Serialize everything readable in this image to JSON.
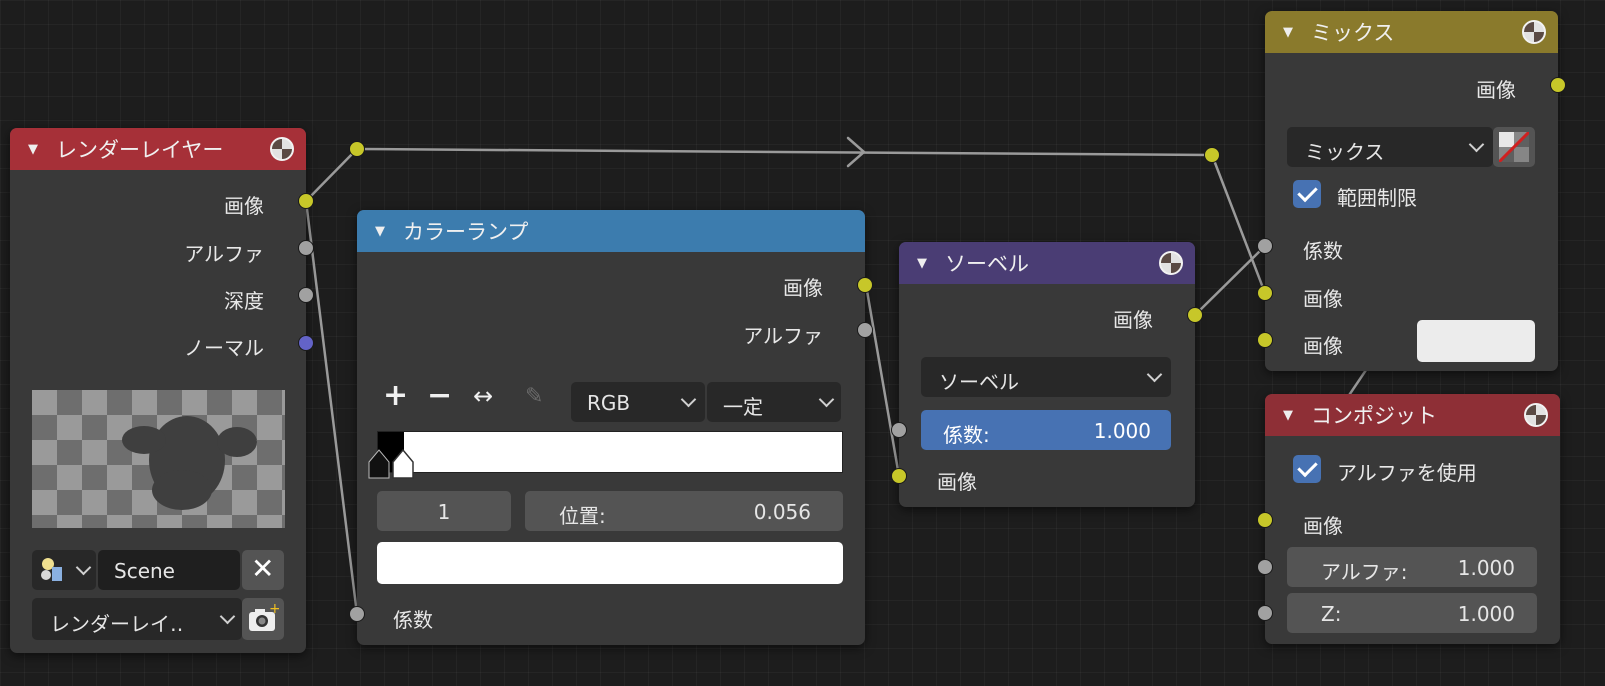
{
  "render_layers": {
    "title": "レンダーレイヤー",
    "header_color": "#a63038",
    "outputs": [
      "画像",
      "アルファ",
      "深度",
      "ノーマル"
    ],
    "scene": "Scene",
    "layer": "レンダーレイ‥"
  },
  "color_ramp": {
    "title": "カラーランプ",
    "header_color": "#3c7cae",
    "outputs": [
      "画像",
      "アルファ"
    ],
    "color_mode": "RGB",
    "interpolation": "一定",
    "stop_index": "1",
    "position_label": "位置:",
    "position_value": "0.056",
    "input": "係数"
  },
  "sobel": {
    "title": "ソーベル",
    "header_color": "#4a3d74",
    "output": "画像",
    "filter_type": "ソーベル",
    "fac_label": "係数:",
    "fac_value": "1.000",
    "input": "画像"
  },
  "mix": {
    "title": "ミックス",
    "header_color": "#8a7a2c",
    "output": "画像",
    "blend_type": "ミックス",
    "clamp_label": "範囲制限",
    "clamp_checked": true,
    "inputs": [
      "係数",
      "画像",
      "画像"
    ]
  },
  "composite": {
    "title": "コンポジット",
    "header_color": "#8e2f36",
    "use_alpha_label": "アルファを使用",
    "use_alpha_checked": true,
    "image_input": "画像",
    "alpha_label": "アルファ:",
    "alpha_value": "1.000",
    "z_label": "Z:",
    "z_value": "1.000"
  },
  "colors": {
    "image_socket": "#c7c729",
    "value_socket": "#a1a1a1",
    "vector_socket": "#6363c7",
    "accent": "#4772b3"
  }
}
